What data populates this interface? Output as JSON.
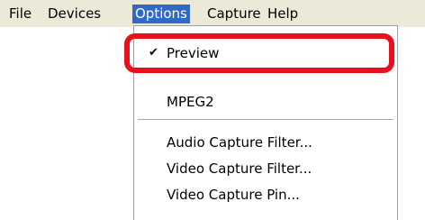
{
  "menubar": {
    "items": [
      "File",
      "Devices",
      "Options",
      "Capture",
      "Help"
    ]
  },
  "options_menu": {
    "items": {
      "preview": "Preview",
      "mpeg2": "MPEG2",
      "audio_capture_filter": "Audio Capture Filter...",
      "video_capture_filter": "Video Capture Filter...",
      "video_capture_pin": "Video Capture Pin..."
    },
    "check_glyph": "✔"
  },
  "colors": {
    "menubar_bg": "#ece9d8",
    "selected_menu_bg": "#316ac5",
    "highlight_ring": "#e8101c"
  },
  "icons": {
    "checkmark": "check-icon"
  }
}
